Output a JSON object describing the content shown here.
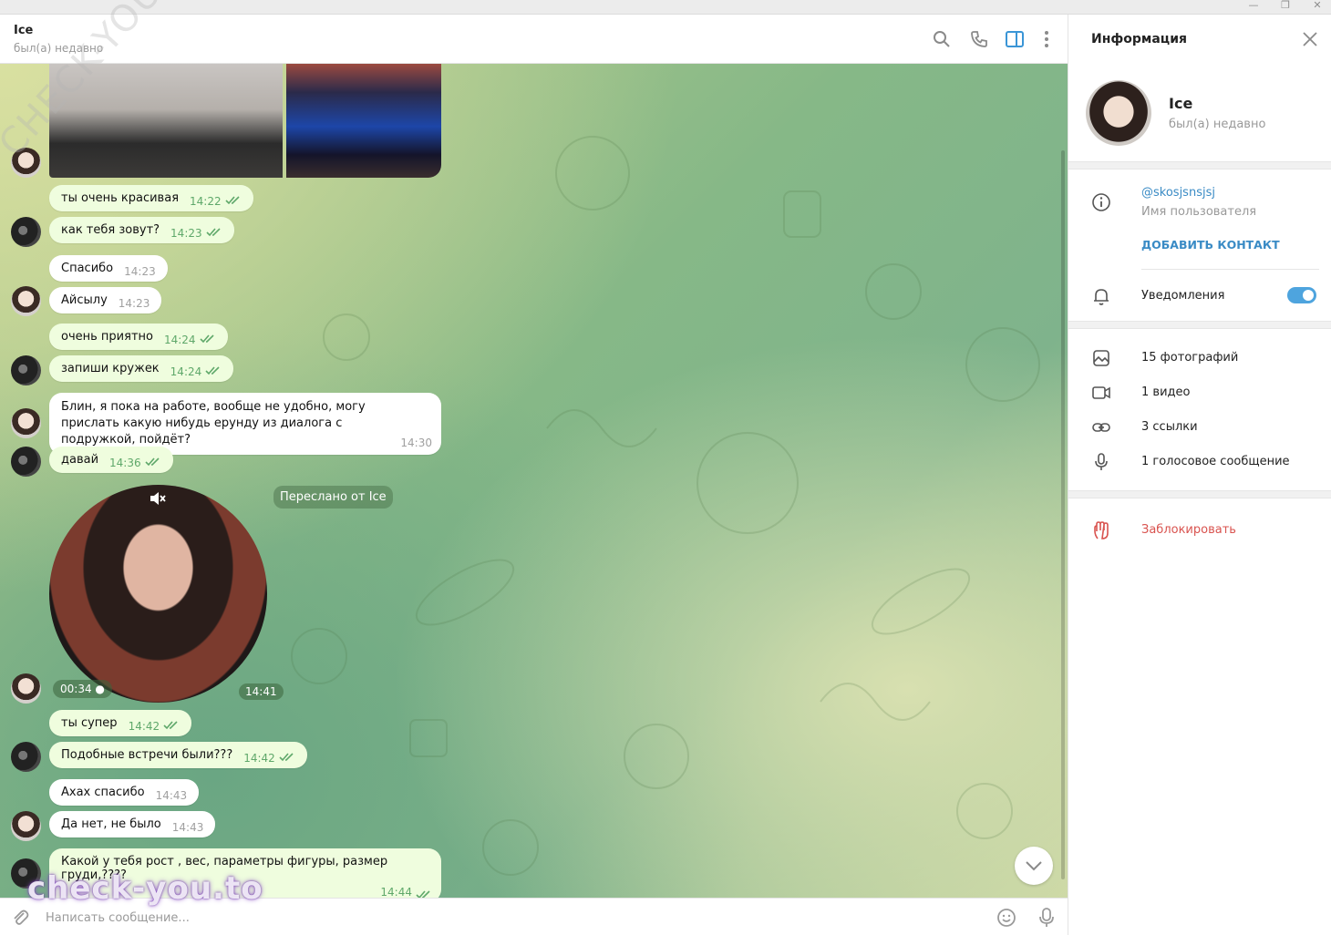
{
  "window": {
    "minimize": "—",
    "restore": "❐",
    "close": "✕"
  },
  "header": {
    "name": "Ice",
    "status": "был(а) недавно"
  },
  "watermarks": {
    "bottom": "check-you.to",
    "diagonal": "CHECK-YOU.ME"
  },
  "messages": [
    {
      "text": "ты очень красивая",
      "time": "14:22"
    },
    {
      "text": "как тебя зовут?",
      "time": "14:23"
    },
    {
      "text": "Спасибо",
      "time": "14:23"
    },
    {
      "text": "Айсылу",
      "time": "14:23"
    },
    {
      "text": "очень приятно",
      "time": "14:24"
    },
    {
      "text": "запиши кружек",
      "time": "14:24"
    },
    {
      "text": "Блин, я пока на работе, вообще не удобно, могу прислать какую нибудь ерунду из диалога с подружкой, пойдёт?",
      "time": "14:30"
    },
    {
      "text": "давай",
      "time": "14:36"
    },
    {
      "text": "ты супер",
      "time": "14:42"
    },
    {
      "text": "Подобные встречи были???",
      "time": "14:42"
    },
    {
      "text": "Ахах спасибо",
      "time": "14:43"
    },
    {
      "text": "Да нет, не было",
      "time": "14:43"
    },
    {
      "text": "Какой у тебя рост , вес, параметры фигуры, размер груди,????",
      "time": "14:44"
    }
  ],
  "video_note": {
    "forwarded_label": "Переслано от Ice",
    "duration": "00:34 ●",
    "time": "14:41"
  },
  "input": {
    "placeholder": "Написать сообщение..."
  },
  "sidebar": {
    "title": "Информация",
    "name": "Ice",
    "status": "был(а) недавно",
    "username": "@skosjsnsjsj",
    "username_label": "Имя пользователя",
    "add_contact": "ДОБАВИТЬ КОНТАКТ",
    "notifications": "Уведомления",
    "notifications_on": true,
    "photos": "15 фотографий",
    "videos": "1 видео",
    "links": "3 ссылки",
    "voice": "1 голосовое сообщение",
    "block": "Заблокировать"
  },
  "colors": {
    "accent": "#4ea4de",
    "outgoing_bubble": "#effdde",
    "check_green": "#5fa86a",
    "danger": "#d9534f"
  }
}
